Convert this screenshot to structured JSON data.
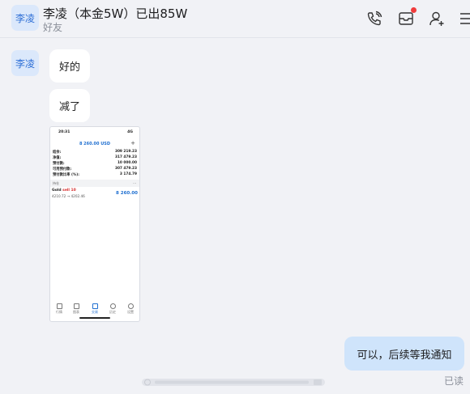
{
  "header": {
    "avatar_label": "李凌",
    "title": "李凌（本金5W）已出85W",
    "subtitle": "好友",
    "icons": [
      "call-icon",
      "message-box-icon",
      "add-contact-icon",
      "more-icon"
    ]
  },
  "messages": {
    "sender_avatar": "李凌",
    "incoming": [
      "好的",
      "减了"
    ],
    "outgoing": "可以，后续等我通知",
    "read_status": "已读"
  },
  "phone_screenshot": {
    "time": "20:31",
    "signal": "4G",
    "amount": "8 260.00 USD",
    "rows": [
      {
        "label": "结余:",
        "value": "309 219.23"
      },
      {
        "label": "净值:",
        "value": "317 479.23"
      },
      {
        "label": "预付款:",
        "value": "10 000.00"
      },
      {
        "label": "可用预付款:",
        "value": "307 479.23"
      },
      {
        "label": "预付款比率 (%):",
        "value": "3 174.79"
      }
    ],
    "section": "持仓",
    "section_more": "···",
    "position": {
      "symbol": "Gold",
      "side": "sell 10",
      "price_from": "4210.72",
      "price_to": "4202.46",
      "profit": "8 260.00"
    },
    "nav": [
      "行情",
      "图表",
      "交易",
      "历史",
      "设置"
    ]
  }
}
